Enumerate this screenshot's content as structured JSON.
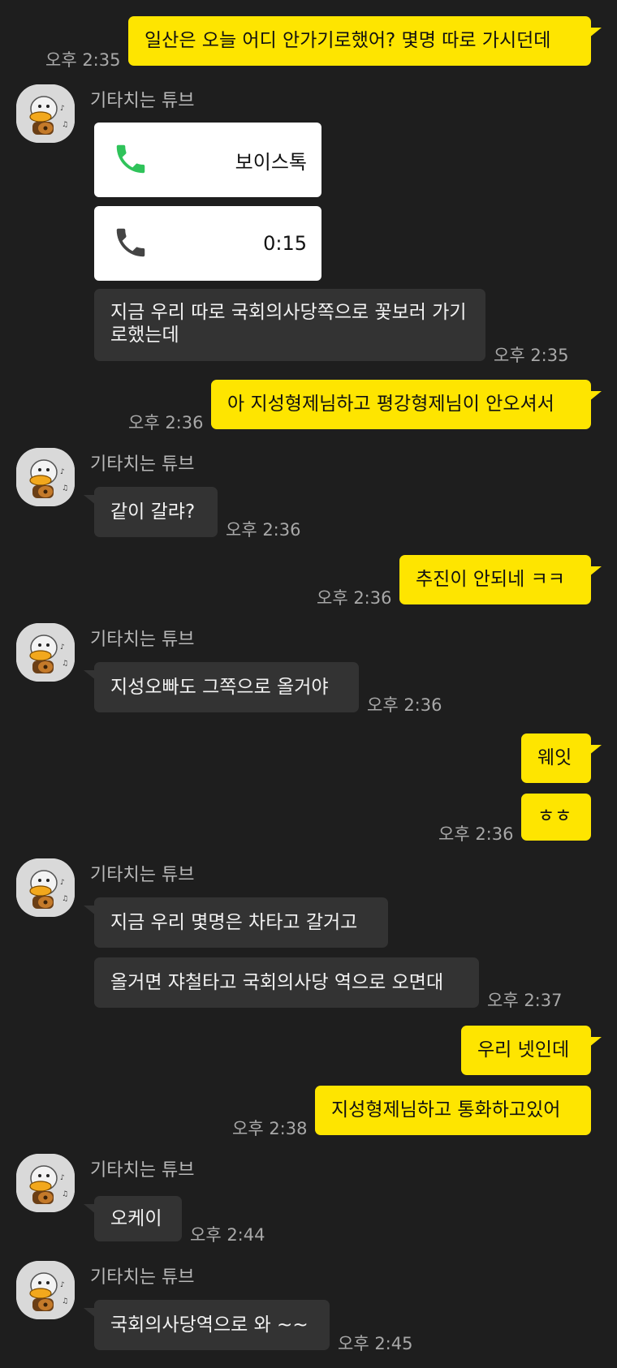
{
  "sender": {
    "name": "기타치는 튜브"
  },
  "colors": {
    "background": "#1e1e1e",
    "my_bubble": "#fee500",
    "their_bubble": "#333333",
    "call_green": "#2fc35a",
    "call_gray": "#444444"
  },
  "messages": {
    "m1": {
      "text": "일산은 오늘 어디 안가기로했어? 몇명 따로 가시던데",
      "time": "오후 2:35"
    },
    "call1": {
      "label": "보이스톡",
      "icon": "phone-icon-green"
    },
    "call2": {
      "label": "0:15",
      "icon": "phone-icon-gray"
    },
    "m2": {
      "text": "지금 우리 따로 국회의사당쪽으로 꽃보러 가기로했는데",
      "time": "오후 2:35"
    },
    "m3": {
      "text": "아 지성형제님하고 평강형제님이 안오셔서",
      "time": "오후 2:36"
    },
    "m4": {
      "text": "같이 갈랴?",
      "time": "오후 2:36"
    },
    "m5": {
      "text": "추진이 안되네 ㅋㅋ",
      "time": "오후 2:36"
    },
    "m6": {
      "text": "지성오빠도 그쪽으로 올거야",
      "time": "오후 2:36"
    },
    "m7": {
      "text": "웨잇"
    },
    "m8": {
      "text": "ㅎㅎ",
      "time": "오후 2:36"
    },
    "m9": {
      "text": "지금 우리 몇명은 차타고 갈거고"
    },
    "m10": {
      "text": "올거면 쟈철타고 국회의사당 역으로 오면대",
      "time": "오후 2:37"
    },
    "m11": {
      "text": "우리 넷인데"
    },
    "m12": {
      "text": "지성형제님하고 통화하고있어",
      "time": "오후 2:38"
    },
    "m13": {
      "text": "오케이",
      "time": "오후 2:44"
    },
    "m14": {
      "text": "국회의사당역으로 와 ~~",
      "time": "오후 2:45"
    }
  }
}
